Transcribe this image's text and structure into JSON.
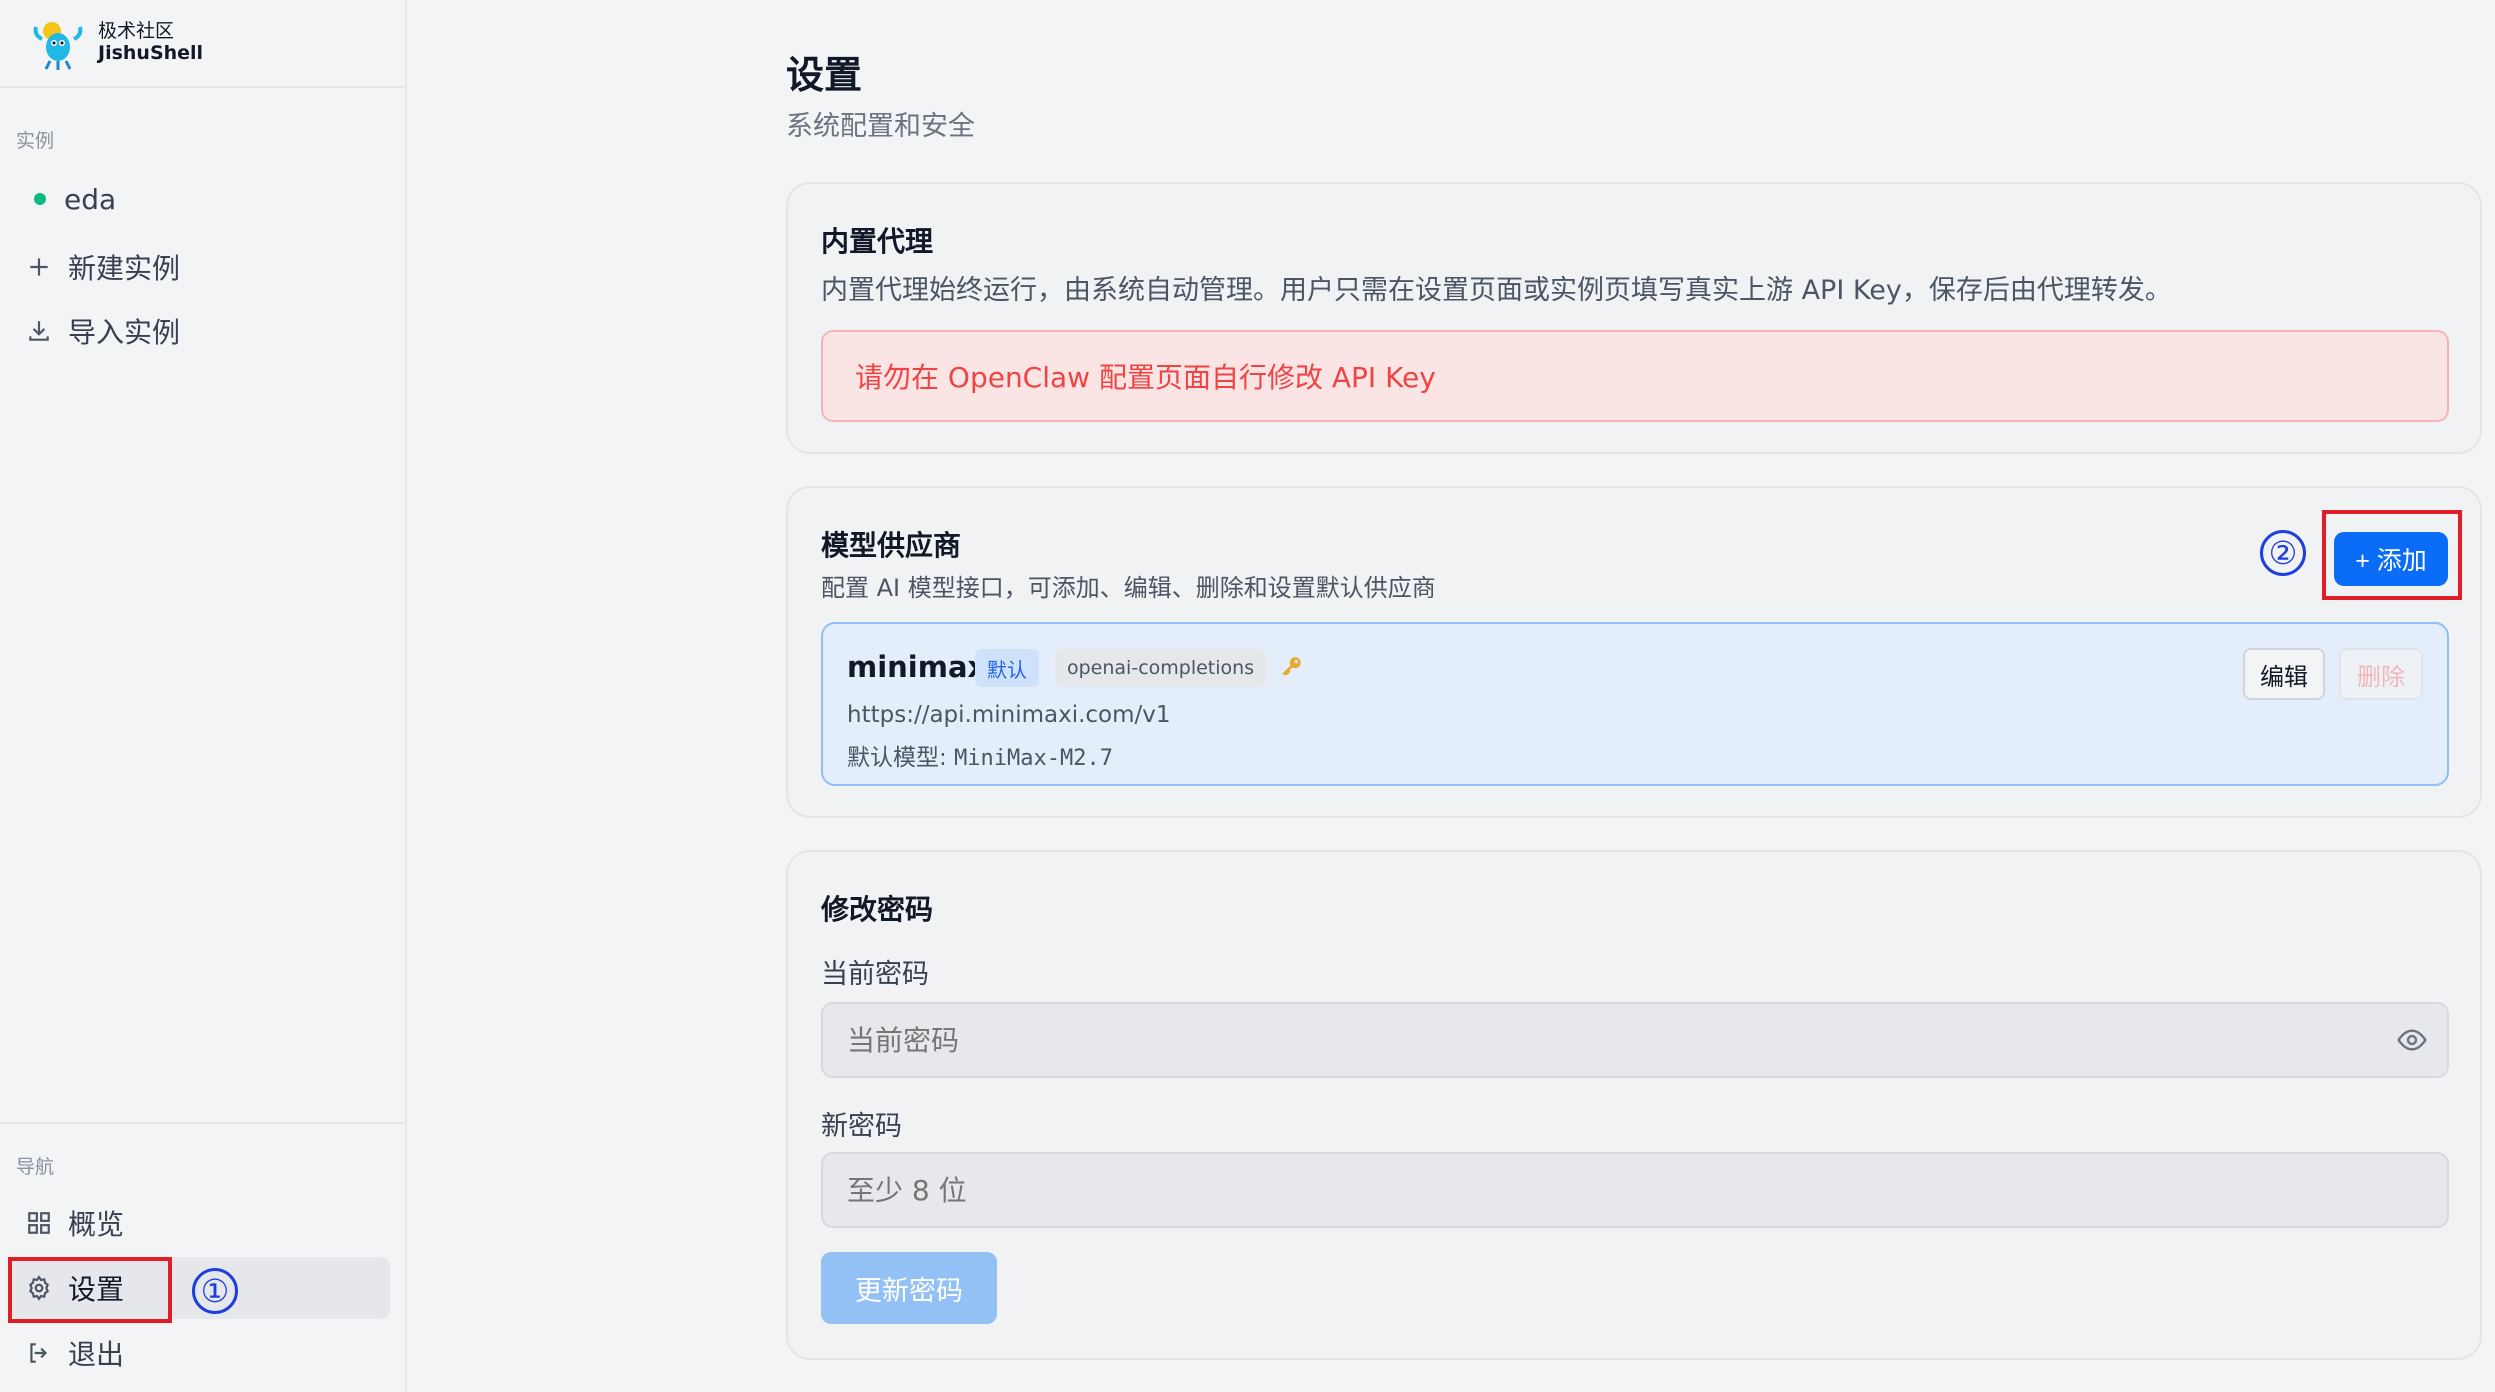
{
  "brand": {
    "name_cn": "极术社区",
    "name_en": "JishuShell"
  },
  "sidebar": {
    "instances_label": "实例",
    "instance": {
      "name": "eda",
      "status_color": "#10b981"
    },
    "actions": [
      {
        "label": "新建实例",
        "icon": "plus-icon"
      },
      {
        "label": "导入实例",
        "icon": "import-icon"
      }
    ],
    "nav_label": "导航",
    "nav": [
      {
        "label": "概览",
        "icon": "grid-icon"
      },
      {
        "label": "设置",
        "icon": "gear-icon",
        "active": true
      },
      {
        "label": "退出",
        "icon": "logout-icon"
      }
    ]
  },
  "annotations": {
    "step1": "①",
    "step2": "②",
    "box_color": "#e11d27",
    "circle_color": "#1d3ee0"
  },
  "page": {
    "title": "设置",
    "subtitle": "系统配置和安全"
  },
  "proxy": {
    "title": "内置代理",
    "desc": "内置代理始终运行，由系统自动管理。用户只需在设置页面或实例页填写真实上游 API Key，保存后由代理转发。",
    "alert": "请勿在 OpenClaw 配置页面自行修改 API Key"
  },
  "providers": {
    "title": "模型供应商",
    "desc": "配置 AI 模型接口，可添加、编辑、删除和设置默认供应商",
    "add_label": "+ 添加",
    "items": [
      {
        "name": "minimax",
        "default_badge": "默认",
        "api_type": "openai-completions",
        "url": "https://api.minimaxi.com/v1",
        "model_label": "默认模型: ",
        "model": "MiniMax-M2.7",
        "edit_label": "编辑",
        "delete_label": "删除"
      }
    ]
  },
  "password": {
    "title": "修改密码",
    "current_label": "当前密码",
    "current_placeholder": "当前密码",
    "new_label": "新密码",
    "new_placeholder": "至少 8 位",
    "submit_label": "更新密码"
  },
  "colors": {
    "accent": "#0a6cf7",
    "danger": "#ef4444"
  }
}
